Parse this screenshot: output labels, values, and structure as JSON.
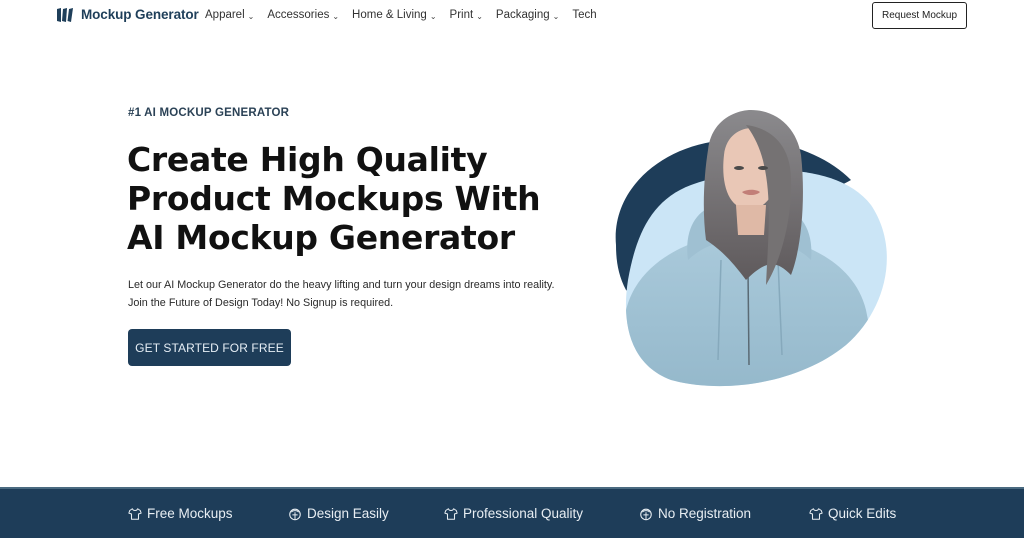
{
  "header": {
    "brand": "Mockup Generator",
    "nav": [
      {
        "label": "Apparel",
        "has_dropdown": true
      },
      {
        "label": "Accessories",
        "has_dropdown": true
      },
      {
        "label": "Home & Living",
        "has_dropdown": true
      },
      {
        "label": "Print",
        "has_dropdown": true
      },
      {
        "label": "Packaging",
        "has_dropdown": true
      },
      {
        "label": "Tech",
        "has_dropdown": false
      }
    ],
    "chevron": "⌄",
    "request_button": "Request Mockup"
  },
  "hero": {
    "eyebrow": "#1 AI MOCKUP GENERATOR",
    "title_lines": [
      "Create High Quality",
      "Product Mockups With",
      "AI Mockup Generator"
    ],
    "subtitle_lines": [
      "Let our AI Mockup Generator do the heavy lifting and turn your design dreams into reality.",
      "Join the Future of Design Today! No Signup is required."
    ],
    "cta": "GET STARTED FOR FREE",
    "image_alt": "woman-in-light-blue-hoodie"
  },
  "features": [
    {
      "icon": "tshirt-icon",
      "label": "Free Mockups"
    },
    {
      "icon": "hoodie-icon",
      "label": "Design Easily"
    },
    {
      "icon": "tshirt-icon",
      "label": "Professional Quality"
    },
    {
      "icon": "hoodie-icon",
      "label": "No Registration"
    },
    {
      "icon": "tshirt-icon",
      "label": "Quick Edits"
    }
  ],
  "colors": {
    "brand_navy": "#1e3d59",
    "accent_light_blue": "#cbe5f6",
    "text_dark": "#111111"
  }
}
